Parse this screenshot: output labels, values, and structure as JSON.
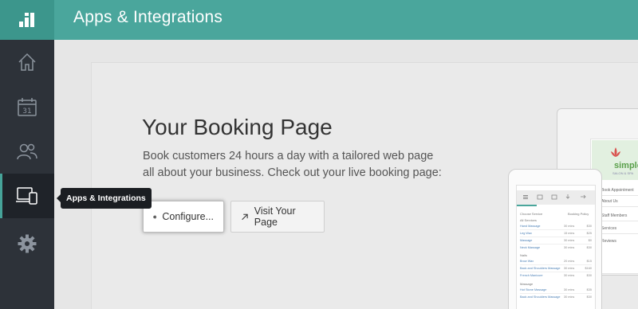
{
  "header": {
    "title": "Apps & Integrations"
  },
  "sidebar": {
    "items": [
      {
        "name": "home",
        "icon": "home-icon"
      },
      {
        "name": "calendar",
        "icon": "calendar-icon",
        "label": "31"
      },
      {
        "name": "customers",
        "icon": "people-icon"
      },
      {
        "name": "apps-integrations",
        "icon": "devices-icon",
        "active": true
      },
      {
        "name": "settings",
        "icon": "gear-icon"
      }
    ]
  },
  "tooltip": {
    "text": "Apps & Integrations"
  },
  "main": {
    "title": "Your Booking Page",
    "description": "Book customers 24 hours a day with a tailored web page all about your business. Check out your live booking page:",
    "configure_button": "Configure...",
    "visit_button": "Visit Your Page"
  },
  "preview": {
    "monitor": {
      "logo_text": "simple",
      "logo_sub": "SALON & SPA",
      "links": [
        "Book Appointment",
        "About Us",
        "Staff Members",
        "Services",
        "Reviews"
      ]
    },
    "tablet": {
      "header": "Choose Service",
      "header_right": "Booking Policy",
      "groups": [
        {
          "title": "All Services",
          "rows": [
            {
              "name": "Hand Massage",
              "time": "30 mins",
              "price": "$30"
            },
            {
              "name": "Leg Wax",
              "time": "15 mins",
              "price": "$25"
            },
            {
              "name": "Massage",
              "time": "30 mins",
              "price": "$0"
            },
            {
              "name": "Neck Massage",
              "time": "30 mins",
              "price": "$30"
            }
          ]
        },
        {
          "title": "Nails",
          "rows": [
            {
              "name": "Brow Wax",
              "time": "20 mins",
              "price": "$15"
            },
            {
              "name": "Back and Shoulders Massage",
              "time": "30 mins",
              "price": "$160"
            },
            {
              "name": "French Manicure",
              "time": "30 mins",
              "price": "$30"
            }
          ]
        },
        {
          "title": "Massage",
          "rows": [
            {
              "name": "Hot Stone Massage",
              "time": "30 mins",
              "price": "$35"
            },
            {
              "name": "Back and Shoulders Massage",
              "time": "30 mins",
              "price": "$30"
            }
          ]
        }
      ]
    }
  },
  "colors": {
    "accent": "#4aa69c",
    "sidebar": "#2d3239",
    "tooltip": "#1b1e22"
  }
}
